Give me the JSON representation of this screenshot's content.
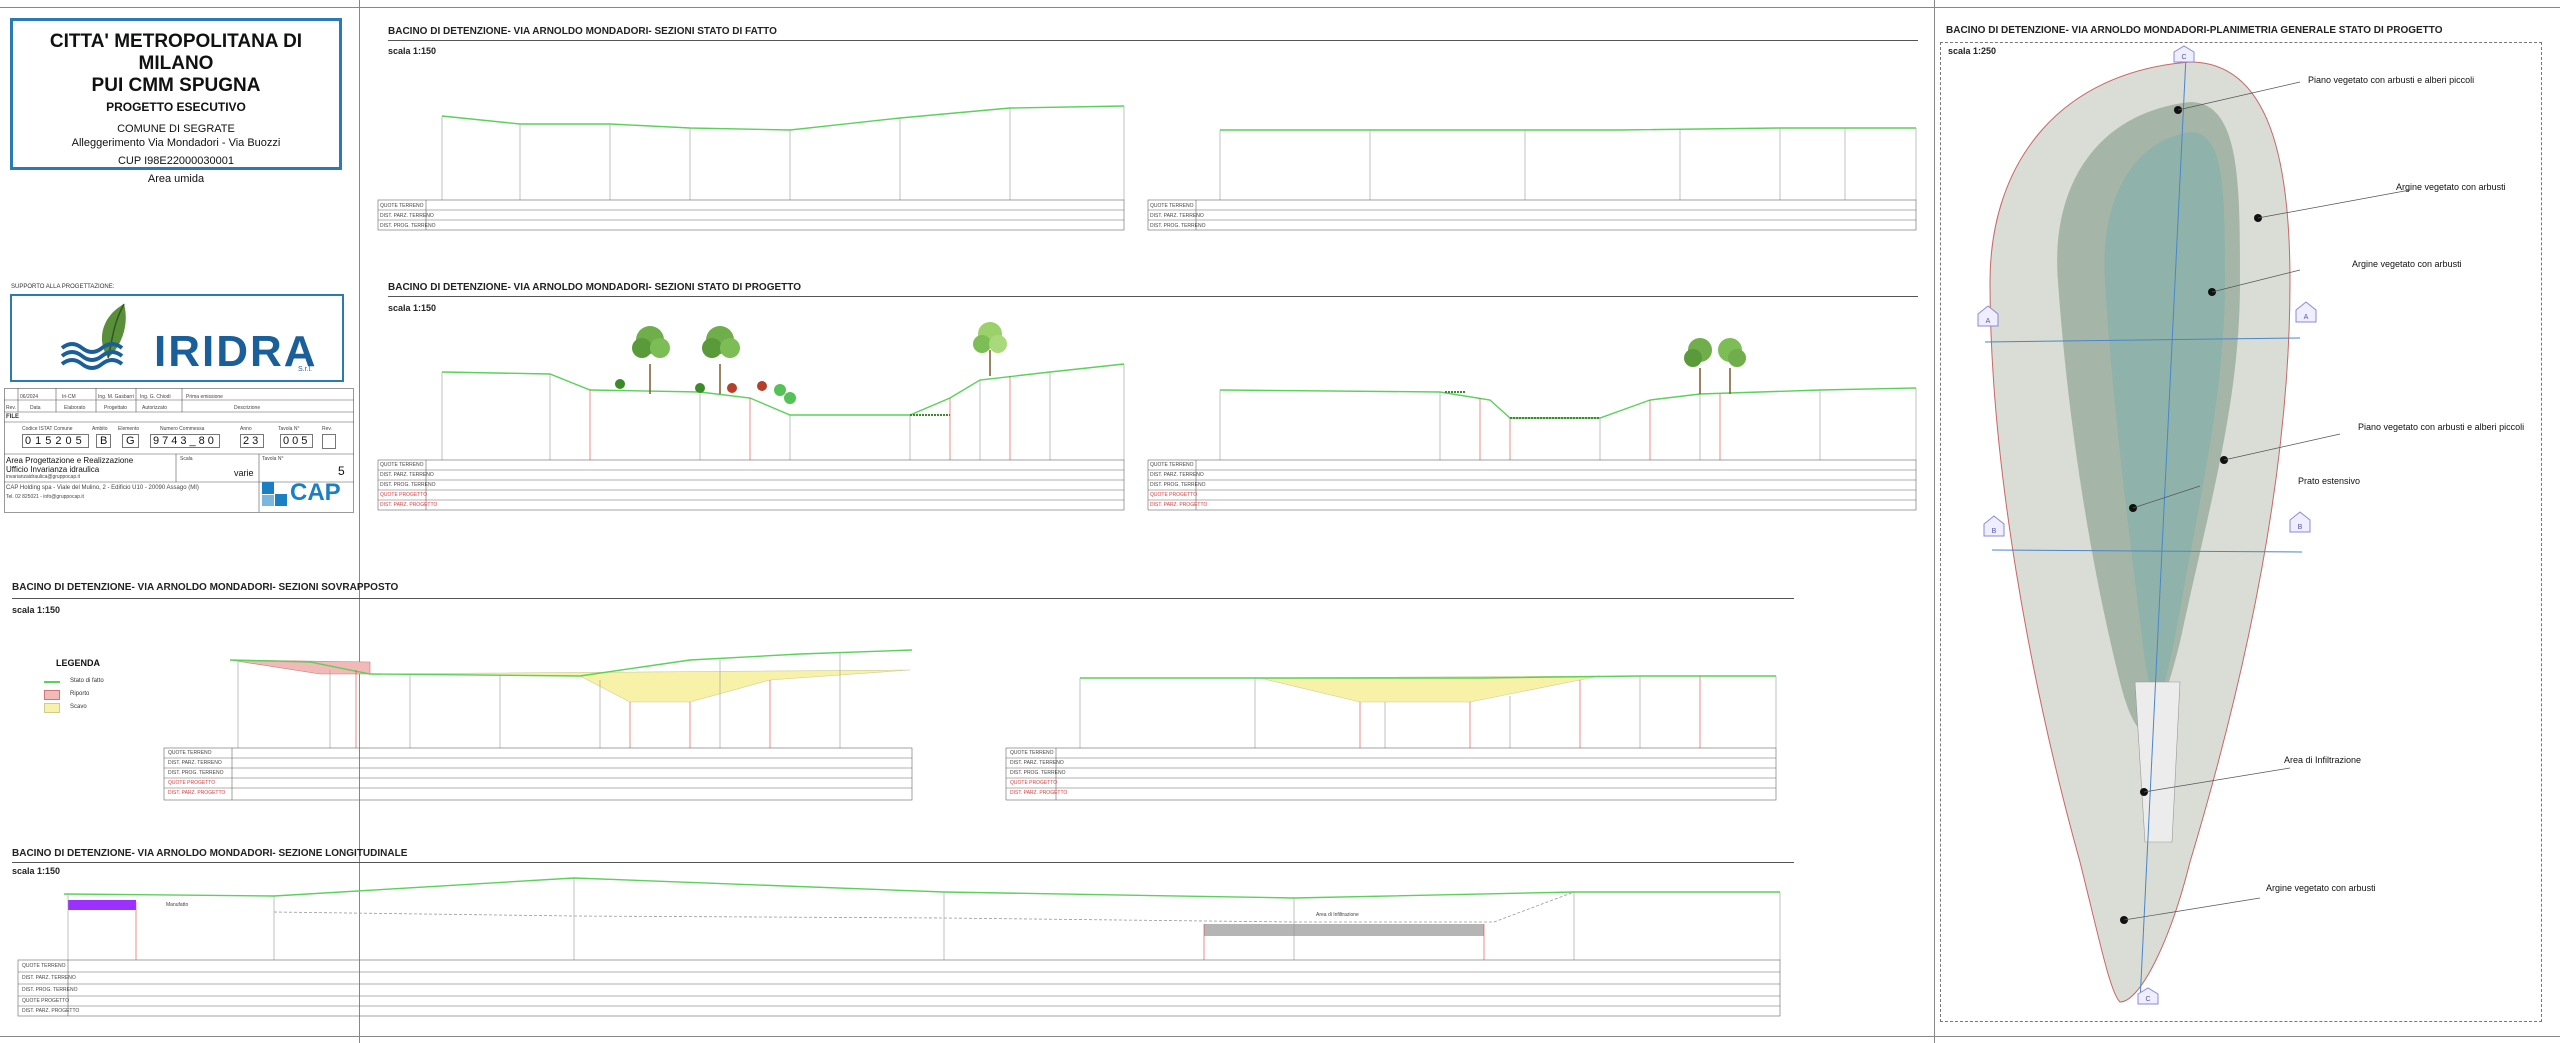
{
  "title_block": {
    "entity": "CITTA' METROPOLITANA DI MILANO",
    "project_name": "PUI CMM SPUGNA",
    "phase": "PROGETTO ESECUTIVO",
    "municipality": "COMUNE DI SEGRATE",
    "subject": "Alleggerimento Via Mondadori - Via Buozzi",
    "cup": "CUP I98E22000030001",
    "area": "Area umida"
  },
  "support": {
    "label": "SUPPORTO ALLA PROGETTAZIONE:",
    "logo_text": "IRIDRA",
    "logo_suffix": "S.r.l."
  },
  "revision_table": {
    "row": [
      "00",
      "06/2024",
      "Iri-CM",
      "Ing. M. Gasbarri",
      "Ing. G. Chiodi",
      "Prima emissione"
    ],
    "headers": [
      "Rev.",
      "Data",
      "Elaborato",
      "Progettato",
      "Autorizzato",
      "Descrizione"
    ]
  },
  "file_code": {
    "label": "FILE",
    "headers": [
      "Codice ISTAT Comune",
      "Ambito",
      "Elemento",
      "Numero Commessa",
      "Anno",
      "Tavola N°",
      "Rev."
    ],
    "istat": "015205",
    "ambito": "B",
    "elemento": "G",
    "commessa": "9743_80",
    "anno": "23",
    "tavola": "005",
    "rev": ""
  },
  "office": {
    "area": "Area Progettazione e Realizzazione",
    "unit": "Ufficio Invarianza idraulica",
    "email": "invarianzaidraulica@gruppocap.it",
    "scale_label": "Scala",
    "scale_value": "varie",
    "sheet_label": "Tavola N°",
    "sheet_value": "5",
    "company": "CAP Holding spa - Viale del Mulino, 2 - Edificio U10 - 20090 Assago (MI)",
    "contact": "Tel. 02 825021 - info@gruppocap.it",
    "brand": "CAP"
  },
  "sections": {
    "stato_fatto": {
      "title": "BACINO DI DETENZIONE- VIA ARNOLDO MONDADORI- SEZIONI STATO DI FATTO",
      "scale": "scala 1:150"
    },
    "stato_progetto": {
      "title": "BACINO DI DETENZIONE- VIA ARNOLDO MONDADORI- SEZIONI STATO DI PROGETTO",
      "scale": "scala 1:150"
    },
    "sovrapposto": {
      "title": "BACINO DI DETENZIONE- VIA ARNOLDO MONDADORI- SEZIONI SOVRAPPOSTO",
      "scale": "scala 1:150"
    },
    "longitudinale": {
      "title": "BACINO DI DETENZIONE- VIA ARNOLDO MONDADORI- SEZIONE LONGITUDINALE",
      "scale": "scala 1:150"
    },
    "planimetria": {
      "title": "BACINO DI DETENZIONE- VIA ARNOLDO MONDADORI-PLANIMETRIA GENERALE STATO DI PROGETTO",
      "scale": "scala 1:250"
    }
  },
  "legend": {
    "title": "LEGENDA",
    "items": [
      {
        "label": "Stato di fatto",
        "color": "#59d259"
      },
      {
        "label": "Riporto",
        "color": "#f2b9b9"
      },
      {
        "label": "Scavo",
        "color": "#f7f2a8"
      }
    ]
  },
  "table_rows": {
    "fatto": [
      "QUOTE TERRENO",
      "DIST. PARZ. TERRENO",
      "DIST. PROG. TERRENO"
    ],
    "progetto": [
      "QUOTE TERRENO",
      "DIST. PARZ. TERRENO",
      "DIST. PROG. TERRENO",
      "QUOTE PROGETTO",
      "DIST. PARZ. PROGETTO"
    ]
  },
  "long_labels": {
    "basin": "Area di Infiltrazione",
    "inlet": "Manufatto"
  },
  "plan_labels": [
    "Piano vegetato con arbusti e alberi piccoli",
    "Argine vegetato con arbusti",
    "Argine vegetato con arbusti",
    "Piano vegetato con arbusti e alberi piccoli",
    "Prato estensivo",
    "Area di Infiltrazione",
    "Argine vegetato con arbusti"
  ],
  "section_markers": [
    "A",
    "A",
    "B",
    "B",
    "C",
    "C"
  ],
  "colors": {
    "terrain": "#59d259",
    "cut_fill": "#f7f2a8",
    "riporto": "#f2b9b9",
    "section_red": "#d94141",
    "frame_blue": "#2a7ab5",
    "marker": "#8a8ad8",
    "purple": "#9b30ff"
  }
}
